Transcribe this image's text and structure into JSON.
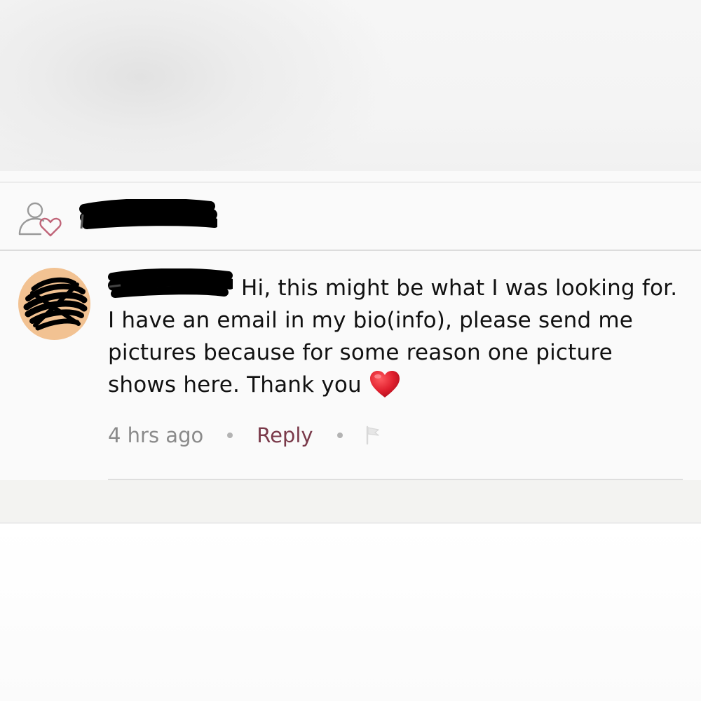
{
  "post_header": {
    "follow_icon": "user-heart-icon",
    "username_redacted": true
  },
  "comment": {
    "author_redacted": true,
    "avatar_color": "#f2c292",
    "text": "Hi, this might be what I was looking for. I have an email in my bio(info), please send me pictures because for some reason one picture shows here. Thank you",
    "emoji": "red-heart",
    "timestamp": "4 hrs ago",
    "reply_label": "Reply",
    "flag_icon": "flag-icon"
  },
  "colors": {
    "reply": "#7a3a4a",
    "heart": "#e0202e",
    "follow_icon_heart": "#c06478",
    "muted_text": "#8a8a8a"
  }
}
